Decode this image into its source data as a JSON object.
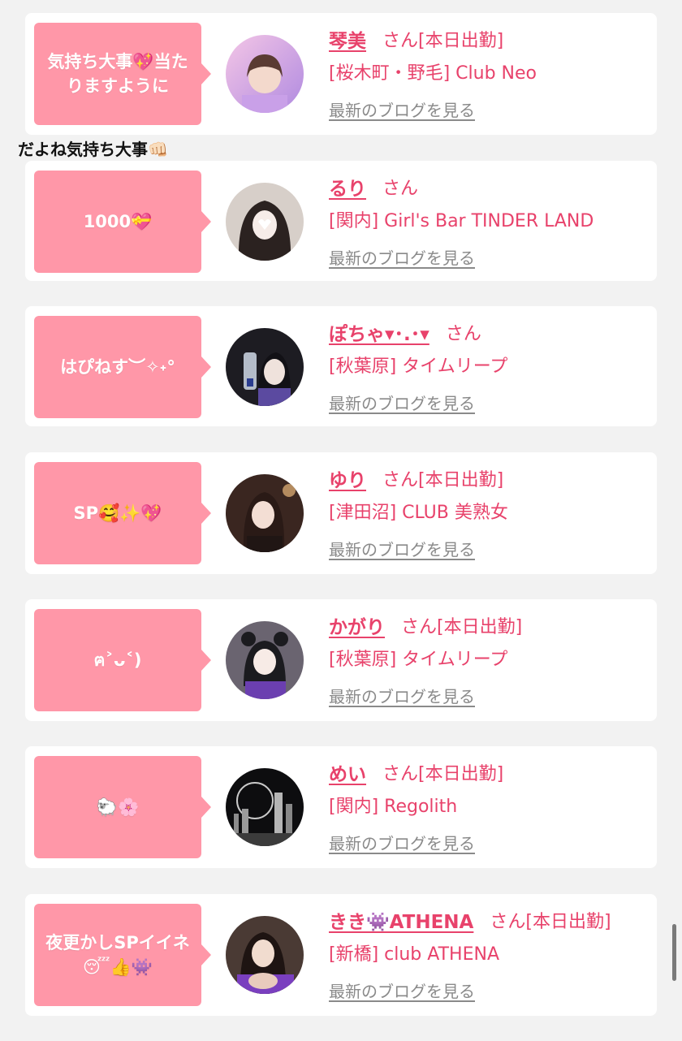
{
  "caption": "だよね気持ち大事👊🏻",
  "entries": [
    {
      "bubble": "気持ち大事💖当たりますように",
      "name": "琴美",
      "san": "さん",
      "status": "[本日出勤]",
      "shop": "[桜木町・野毛] Club Neo",
      "blog": "最新のブログを見る"
    },
    {
      "bubble": "1000💝",
      "name": "るり",
      "san": "さん",
      "status": "",
      "shop": "[関内] Girl's Bar TINDER LAND",
      "blog": "最新のブログを見る"
    },
    {
      "bubble": "はぴねす︶✧˖°",
      "name": "ぽちゃ▾･.･▾",
      "san": "さん",
      "status": "",
      "shop": "[秋葉原] タイムリープ",
      "blog": "最新のブログを見る"
    },
    {
      "bubble": "SP🥰✨💖",
      "name": "ゆり",
      "san": "さん",
      "status": "[本日出勤]",
      "shop": "[津田沼] CLUB 美熟女",
      "blog": "最新のブログを見る"
    },
    {
      "bubble": "ฅ˃ᴗ˂)",
      "name": "かがり",
      "san": "さん",
      "status": "[本日出勤]",
      "shop": "[秋葉原] タイムリープ",
      "blog": "最新のブログを見る"
    },
    {
      "bubble": "🐑🌸",
      "name": "めい",
      "san": "さん",
      "status": "[本日出勤]",
      "shop": "[関内] Regolith",
      "blog": "最新のブログを見る"
    },
    {
      "bubble": "夜更かしSPイイネ😴👍👾",
      "name": "きき👾ATHENA",
      "san": "さん",
      "status": "[本日出勤]",
      "shop": "[新橋] club ATHENA",
      "blog": "最新のブログを見る"
    }
  ],
  "colors": {
    "accent": "#e8426b",
    "bubble": "#ff97a8",
    "link_gray": "#8a8a8a",
    "background": "#f2f2f2"
  }
}
